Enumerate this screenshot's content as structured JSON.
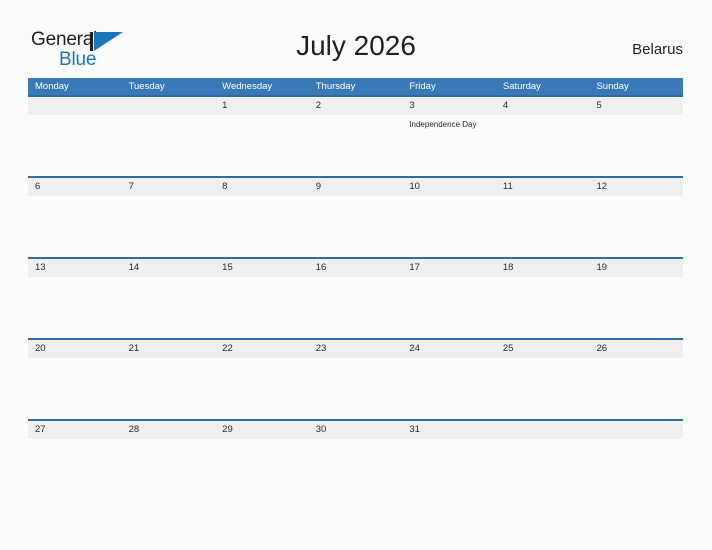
{
  "brand": {
    "word1": "General",
    "word2": "Blue",
    "mark": "triangle-flag-icon",
    "primary_color": "#1b76bc",
    "text_color": "#231f20"
  },
  "header": {
    "title": "July 2026",
    "country": "Belarus"
  },
  "calendar": {
    "header_color": "#3a79b8",
    "band_color": "#efefef",
    "rule_color": "#2e6da4",
    "weekdays": [
      "Monday",
      "Tuesday",
      "Wednesday",
      "Thursday",
      "Friday",
      "Saturday",
      "Sunday"
    ],
    "weeks": [
      [
        {
          "day": "",
          "event": ""
        },
        {
          "day": "",
          "event": ""
        },
        {
          "day": "1",
          "event": ""
        },
        {
          "day": "2",
          "event": ""
        },
        {
          "day": "3",
          "event": "Independence Day"
        },
        {
          "day": "4",
          "event": ""
        },
        {
          "day": "5",
          "event": ""
        }
      ],
      [
        {
          "day": "6",
          "event": ""
        },
        {
          "day": "7",
          "event": ""
        },
        {
          "day": "8",
          "event": ""
        },
        {
          "day": "9",
          "event": ""
        },
        {
          "day": "10",
          "event": ""
        },
        {
          "day": "11",
          "event": ""
        },
        {
          "day": "12",
          "event": ""
        }
      ],
      [
        {
          "day": "13",
          "event": ""
        },
        {
          "day": "14",
          "event": ""
        },
        {
          "day": "15",
          "event": ""
        },
        {
          "day": "16",
          "event": ""
        },
        {
          "day": "17",
          "event": ""
        },
        {
          "day": "18",
          "event": ""
        },
        {
          "day": "19",
          "event": ""
        }
      ],
      [
        {
          "day": "20",
          "event": ""
        },
        {
          "day": "21",
          "event": ""
        },
        {
          "day": "22",
          "event": ""
        },
        {
          "day": "23",
          "event": ""
        },
        {
          "day": "24",
          "event": ""
        },
        {
          "day": "25",
          "event": ""
        },
        {
          "day": "26",
          "event": ""
        }
      ],
      [
        {
          "day": "27",
          "event": ""
        },
        {
          "day": "28",
          "event": ""
        },
        {
          "day": "29",
          "event": ""
        },
        {
          "day": "30",
          "event": ""
        },
        {
          "day": "31",
          "event": ""
        },
        {
          "day": "",
          "event": ""
        },
        {
          "day": "",
          "event": ""
        }
      ]
    ]
  }
}
